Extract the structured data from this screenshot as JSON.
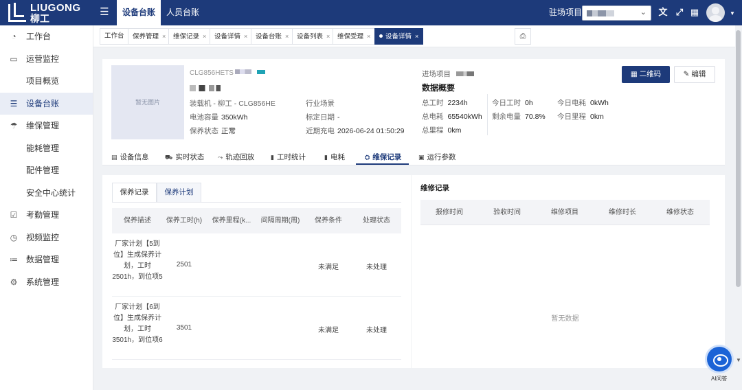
{
  "brand": {
    "name_en": "LIUGONG",
    "name_cn": "柳工"
  },
  "header": {
    "tabs": [
      {
        "label": "设备台账",
        "active": true
      },
      {
        "label": "人员台账",
        "active": false
      }
    ],
    "station_label": "驻场项目:",
    "station_value_redacted": true,
    "icons": [
      "translate-icon",
      "fullscreen-icon",
      "layout-icon",
      "avatar"
    ]
  },
  "sidebar": {
    "items": [
      {
        "label": "工作台",
        "icon": "dashboard-icon"
      },
      {
        "label": "运营监控",
        "icon": "monitor-icon"
      },
      {
        "label": "项目概览",
        "icon": ""
      },
      {
        "label": "设备台账",
        "icon": "device-icon",
        "active": true
      },
      {
        "label": "维保管理",
        "icon": "umbrella-icon"
      },
      {
        "label": "能耗管理",
        "icon": ""
      },
      {
        "label": "配件管理",
        "icon": ""
      },
      {
        "label": "安全中心统计",
        "icon": ""
      },
      {
        "label": "考勤管理",
        "icon": "calendar-check-icon"
      },
      {
        "label": "视频监控",
        "icon": "clock-icon"
      },
      {
        "label": "数据管理",
        "icon": "list-settings-icon"
      },
      {
        "label": "系统管理",
        "icon": "gear-icon"
      }
    ]
  },
  "page_tabs": [
    {
      "label": "工作台",
      "closable": false
    },
    {
      "label": "保养管理",
      "closable": true
    },
    {
      "label": "维保记录",
      "closable": true
    },
    {
      "label": "设备详情",
      "closable": true
    },
    {
      "label": "设备台账",
      "closable": true
    },
    {
      "label": "设备列表",
      "closable": true
    },
    {
      "label": "维保受理",
      "closable": true
    },
    {
      "label": "设备详情",
      "closable": true,
      "active": true
    }
  ],
  "device": {
    "no_image": "暂无图片",
    "model_code": "CLG856HETS",
    "type": "装载机",
    "brand_sep": " - ",
    "brand": "柳工",
    "model": "CLG856HE",
    "industry_label": "行业场景",
    "industry_value": "",
    "battery_label": "电池容量",
    "battery_value": "350kWh",
    "calib_label": "标定日期",
    "calib_value": "-",
    "status_label": "保养状态",
    "status_value": "正常",
    "charge_label": "近期充电",
    "charge_value": "2026-06-24 01:50:29",
    "project_label": "进场项目"
  },
  "overview": {
    "title": "数据概要",
    "items": [
      {
        "label": "总工时",
        "value": "2234h"
      },
      {
        "label": "今日工时",
        "value": "0h"
      },
      {
        "label": "今日电耗",
        "value": "0kWh"
      },
      {
        "label": "总电耗",
        "value": "65540kWh"
      },
      {
        "label": "剩余电量",
        "value": "70.8%"
      },
      {
        "label": "今日里程",
        "value": "0km"
      },
      {
        "label": "总里程",
        "value": "0km"
      }
    ]
  },
  "actions": {
    "qr": "二维码",
    "edit": "编辑"
  },
  "detail_tabs": [
    {
      "label": "设备信息",
      "icon": "info-icon"
    },
    {
      "label": "实时状态",
      "icon": "truck-icon"
    },
    {
      "label": "轨迹回放",
      "icon": "route-icon"
    },
    {
      "label": "工时统计",
      "icon": "bar-chart-icon"
    },
    {
      "label": "电耗",
      "icon": "battery-icon"
    },
    {
      "label": "维保记录",
      "icon": "maintenance-icon",
      "active": true
    },
    {
      "label": "运行参数",
      "icon": "params-icon"
    }
  ],
  "maintenance": {
    "subtabs": [
      {
        "label": "保养记录"
      },
      {
        "label": "保养计划",
        "active": true
      }
    ],
    "columns": [
      "保养描述",
      "保养工时(h)",
      "保养里程(k...",
      "间隔周期(周)",
      "保养条件",
      "处理状态"
    ],
    "rows": [
      {
        "desc": "厂家计划【5到位】生成保养计划，工时2501h，到位项5",
        "hours": "2501",
        "mileage": "",
        "interval": "",
        "condition": "未满足",
        "state": "未处理"
      },
      {
        "desc": "厂家计划【6到位】生成保养计划，工时3501h，到位项6",
        "hours": "3501",
        "mileage": "",
        "interval": "",
        "condition": "未满足",
        "state": "未处理"
      }
    ]
  },
  "repair": {
    "title": "维修记录",
    "columns": [
      "报修时间",
      "验收时间",
      "维修项目",
      "维修时长",
      "维修状态"
    ],
    "empty": "暂无数据"
  },
  "ai": {
    "label": "AI问答"
  }
}
